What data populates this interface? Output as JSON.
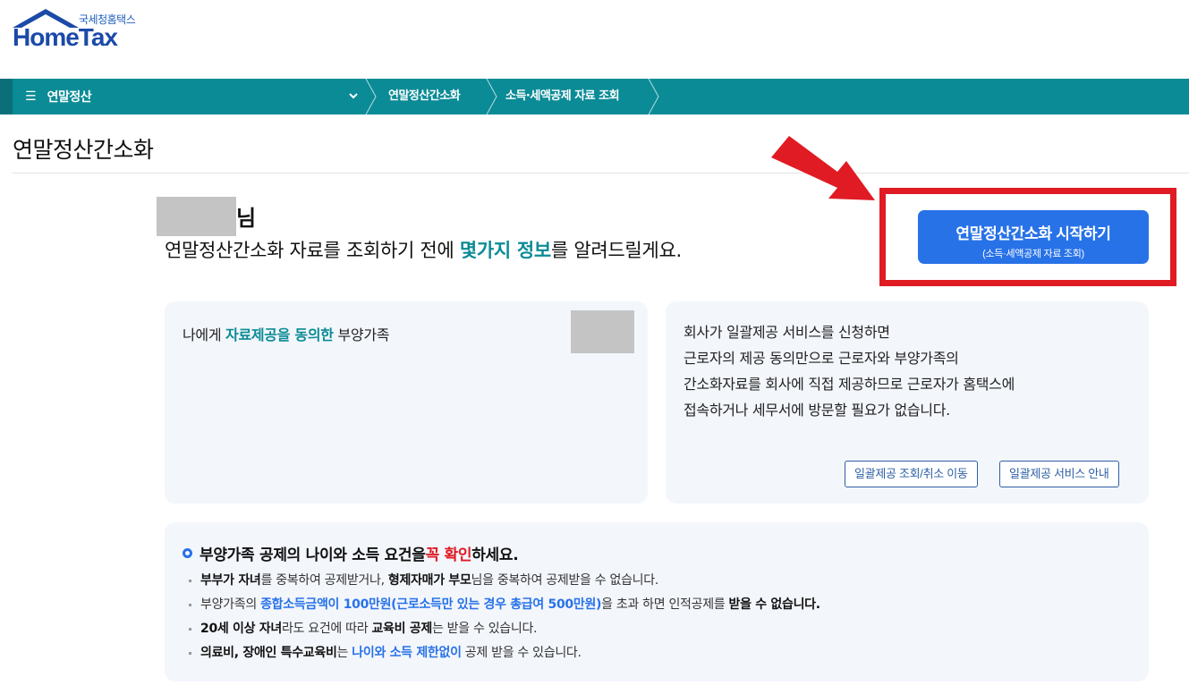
{
  "logo": {
    "small_text": "국세청홈택스",
    "main_text": "HomeTax"
  },
  "nav": {
    "menu_label": "연말정산",
    "breadcrumbs": [
      "연말정산간소화",
      "소득·세액공제 자료 조회"
    ]
  },
  "page": {
    "title": "연말정산간소화"
  },
  "greeting": {
    "name_suffix": "님",
    "line_before": "연말정산간소화 자료를 조회하기 전에 ",
    "line_highlight": "몇가지 정보",
    "line_after": "를 알려드릴게요."
  },
  "start_button": {
    "label": "연말정산간소화 시작하기",
    "sublabel": "(소득·세액공제 자료 조회)"
  },
  "card_left": {
    "title_before": "나에게 ",
    "title_highlight": "자료제공을 동의한",
    "title_after": " 부양가족"
  },
  "card_right": {
    "lines": [
      "회사가 일괄제공 서비스를 신청하면",
      "근로자의 제공 동의만으로 근로자와 부양가족의",
      "간소화자료를 회사에 직접 제공하므로 근로자가 홈택스에",
      "접속하거나 세무서에 방문할 필요가 없습니다."
    ],
    "buttons": [
      "일괄제공 조회/취소 이동",
      "일괄제공 서비스 안내"
    ]
  },
  "notice": {
    "head_before": "부양가족 공제의 나이와 소득 요건을 ",
    "head_red": "꼭 확인",
    "head_after": "하세요.",
    "items": [
      {
        "a": "부부가 자녀",
        "b": "를 중복하여 공제받거나, ",
        "c": "형제자매가 부모",
        "d": "님을 중복하여 공제받을 수 없습니다."
      },
      {
        "a": "부양가족의 ",
        "b": "종합소득금액이 100만원(근로소득만 있는 경우 총급여 500만원)",
        "c": "을 초과 하면 인적공제를 ",
        "d": "받을 수 없습니다."
      },
      {
        "a": "20세 이상 자녀",
        "b": "라도 요건에 따라 ",
        "c": "교육비 공제",
        "d": "는 받을 수 있습니다."
      },
      {
        "a": "의료비, 장애인 특수교육비",
        "b": "는 ",
        "c": "나이와 소득 제한없이",
        "d": " 공제 받을 수 있습니다."
      }
    ]
  },
  "colors": {
    "nav_teal": "#0b8b96",
    "primary_blue": "#2872e8",
    "highlight_red": "#e01b24"
  }
}
